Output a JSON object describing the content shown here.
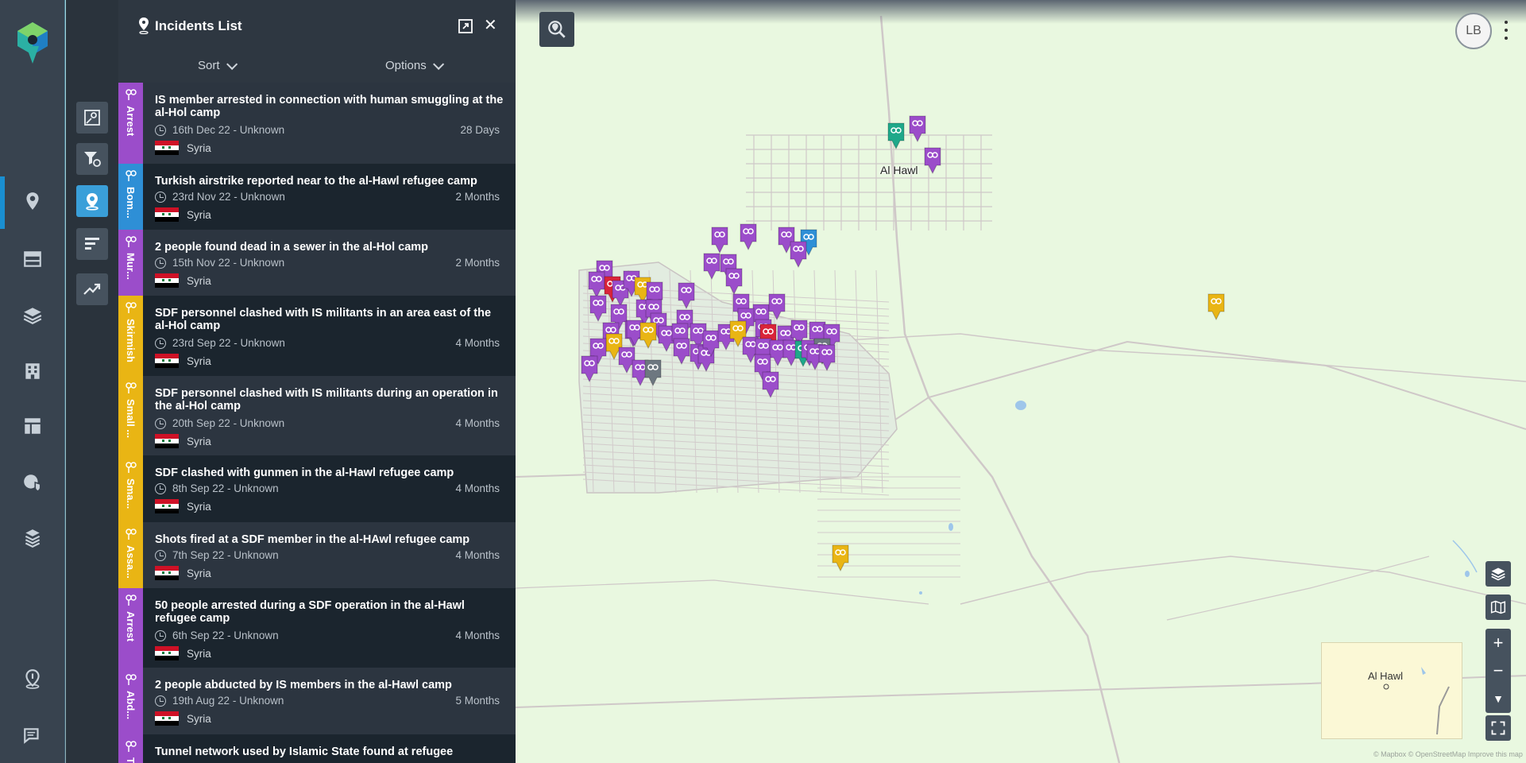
{
  "panel": {
    "title": "Incidents List",
    "sort_label": "Sort",
    "options_label": "Options"
  },
  "incidents": [
    {
      "category": "Arrest",
      "color": "#9b4dca",
      "title": "IS member arrested in connection with human smuggling at the al-Hol camp",
      "date": "16th Dec 22 - Unknown",
      "age": "28 Days",
      "country": "Syria"
    },
    {
      "category": "Bom...",
      "color": "#2e8fd6",
      "title": "Turkish airstrike reported near to the al-Hawl refugee camp",
      "date": "23rd Nov 22 - Unknown",
      "age": "2 Months",
      "country": "Syria"
    },
    {
      "category": "Mur...",
      "color": "#9b4dca",
      "title": "2 people found dead in a sewer in the al-Hol camp",
      "date": "15th Nov 22 - Unknown",
      "age": "2 Months",
      "country": "Syria"
    },
    {
      "category": "Skirmish",
      "color": "#e9b514",
      "title": "SDF personnel clashed with IS militants in an area east of the al-Hol camp",
      "date": "23rd Sep 22 - Unknown",
      "age": "4 Months",
      "country": "Syria"
    },
    {
      "category": "Small ...",
      "color": "#e9b514",
      "title": "SDF personnel clashed with IS militants during an operation in the al-Hol camp",
      "date": "20th Sep 22 - Unknown",
      "age": "4 Months",
      "country": "Syria"
    },
    {
      "category": "Sma...",
      "color": "#e9b514",
      "title": "SDF clashed with gunmen in the al-Hawl refugee camp",
      "date": "8th Sep 22 - Unknown",
      "age": "4 Months",
      "country": "Syria"
    },
    {
      "category": "Assa...",
      "color": "#e9b514",
      "title": "Shots fired at a SDF member in the al-HAwl refugee camp",
      "date": "7th Sep 22 - Unknown",
      "age": "4 Months",
      "country": "Syria"
    },
    {
      "category": "Arrest",
      "color": "#9b4dca",
      "title": "50 people arrested during a SDF operation in the al-Hawl refugee camp",
      "date": "6th Sep 22 - Unknown",
      "age": "4 Months",
      "country": "Syria"
    },
    {
      "category": "Abd...",
      "color": "#9b4dca",
      "title": "2 people abducted by IS members in the al-Hawl camp",
      "date": "19th Aug 22 - Unknown",
      "age": "5 Months",
      "country": "Syria"
    },
    {
      "category": "T",
      "color": "#9b4dca",
      "title": "Tunnel network used by Islamic State found at refugee",
      "date": "",
      "age": "",
      "country": ""
    }
  ],
  "map": {
    "town_label": "Al Hawl",
    "minimap_label": "Al Hawl",
    "user_initials": "LB",
    "attribution": "© Mapbox © OpenStreetMap Improve this map"
  },
  "colors": {
    "purple": "#9b4dca",
    "yellow": "#e9b514",
    "blue": "#2e8fd6",
    "green": "#1fa88a",
    "red": "#d9243a",
    "grey": "#6d7780"
  },
  "icons": {
    "nav": [
      "pin-icon",
      "table-icon",
      "layers-icon",
      "building-icon",
      "layout-icon",
      "globe-shield-icon",
      "stack-icon",
      "location-info-icon",
      "chat-icon"
    ],
    "tools": [
      "map-search-icon",
      "filter-settings-icon",
      "pin-active-icon",
      "bars-icon",
      "trend-icon"
    ]
  }
}
